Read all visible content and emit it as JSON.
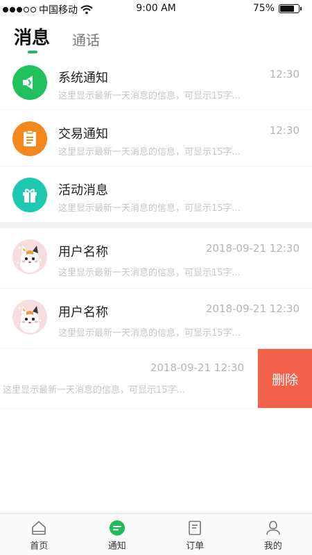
{
  "status_bar": {
    "carrier": "中国移动",
    "time": "9:00 AM",
    "battery": "75%",
    "battery_level": 0.75
  },
  "tabs": {
    "active": "消息",
    "inactive": "通话"
  },
  "system_rows": [
    {
      "title": "系统通知",
      "time": "12:30",
      "preview": "这里显示最新一天消息的信息，可显示15字...",
      "color": "#22c15e",
      "icon": "megaphone-icon"
    },
    {
      "title": "交易通知",
      "time": "12:30",
      "preview": "这里显示最新一天消息的信息，可显示15字...",
      "color": "#f5871f",
      "icon": "clipboard-icon"
    },
    {
      "title": "活动消息",
      "time": "",
      "preview": "这里显示最新一天消息的信息，可显示15字...",
      "color": "#1ec9b0",
      "icon": "gift-icon"
    }
  ],
  "user_rows": [
    {
      "title": "用户名称",
      "time": "2018-09-21 12:30",
      "preview": "这里显示最新一天消息的信息，可显示15字..."
    },
    {
      "title": "用户名称",
      "time": "2018-09-21 12:30",
      "preview": "这里显示最新一天消息的信息，可显示15字..."
    }
  ],
  "swipe_row": {
    "time": "2018-09-21 12:30",
    "preview": "这里显示最新一天消息的信息，可显示15字...",
    "delete_label": "删除"
  },
  "tabbar": [
    {
      "label": "首页",
      "icon": "home-icon"
    },
    {
      "label": "通知",
      "icon": "chat-icon"
    },
    {
      "label": "订单",
      "icon": "order-icon"
    },
    {
      "label": "我的",
      "icon": "profile-icon"
    }
  ],
  "colors": {
    "accent": "#1fbb5a",
    "delete": "#f2624a"
  }
}
